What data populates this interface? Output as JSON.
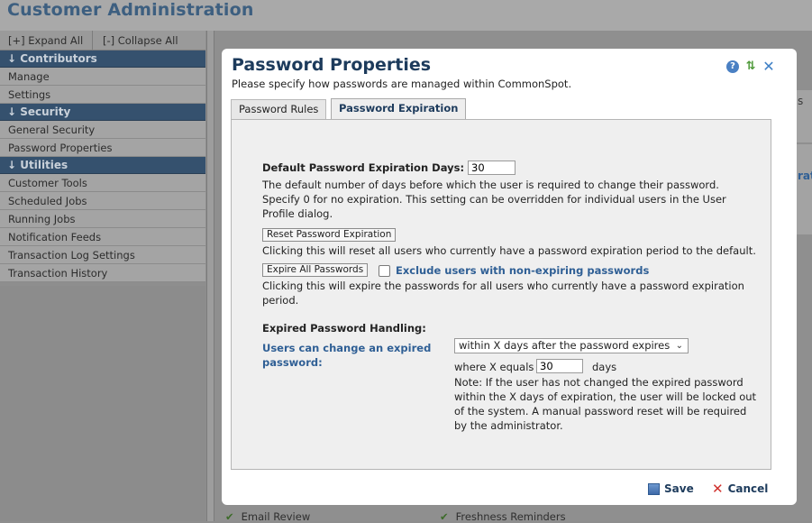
{
  "app": {
    "title": "Customer Administration"
  },
  "expand_bar": {
    "expand_all": "[+] Expand All",
    "collapse_all": "[-] Collapse All"
  },
  "sidebar": {
    "sections": [
      {
        "label": "↓ Contributors",
        "items": [
          "Manage",
          "Settings"
        ]
      },
      {
        "label": "↓ Security",
        "items": [
          "General Security",
          "Password Properties"
        ]
      },
      {
        "label": "↓ Utilities",
        "items": [
          "Customer Tools",
          "Scheduled Jobs",
          "Running Jobs",
          "Notification Feeds",
          "Transaction Log Settings",
          "Transaction History"
        ]
      }
    ]
  },
  "background": {
    "peek_s": "s",
    "peek_rat": "rat",
    "bottom_items": [
      "Email Review",
      "Freshness Reminders"
    ]
  },
  "dialog": {
    "title": "Password Properties",
    "subtitle": "Please specify how passwords are managed within CommonSpot.",
    "icons": [
      "help-icon",
      "refresh-icon",
      "close-icon"
    ],
    "tabs": [
      {
        "label": "Password Rules",
        "active": false
      },
      {
        "label": "Password Expiration",
        "active": true
      }
    ],
    "expiration": {
      "days_label": "Default Password Expiration Days:",
      "days_value": "30",
      "days_help_line1": "The default number of days before which the user is required to change their password.",
      "days_help_line2": "Specify 0 for no expiration. This setting can be overridden for individual users in the User",
      "days_help_line3": "Profile dialog.",
      "reset_button": "Reset Password Expiration",
      "reset_help": "Clicking this will reset all users who currently have a password expiration period to the default.",
      "expire_button": "Expire All Passwords",
      "exclude_label": "Exclude users with non-expiring passwords",
      "exclude_checked": false,
      "expire_help_line1": "Clicking this will expire the passwords for all users who currently have a password expiration",
      "expire_help_line2": "period."
    },
    "expired_handling": {
      "heading": "Expired Password Handling:",
      "label_line1": "Users can change an expired",
      "label_line2": "password:",
      "select_value": "within X days after the password expires",
      "where_label": "where X equals",
      "x_value": "30",
      "days_unit": "days",
      "note_line1": "Note: If the user has not changed the expired password",
      "note_line2": "within the X days of expiration, the user will be locked out",
      "note_line3": "of the system. A manual password reset will be required",
      "note_line4": "by the administrator."
    },
    "footer": {
      "save": "Save",
      "cancel": "Cancel"
    }
  },
  "colors": {
    "title_blue": "#1d3b5c",
    "label_blue": "#2f5f95",
    "section_header": "#35516e",
    "panel_bg": "#efefef"
  }
}
